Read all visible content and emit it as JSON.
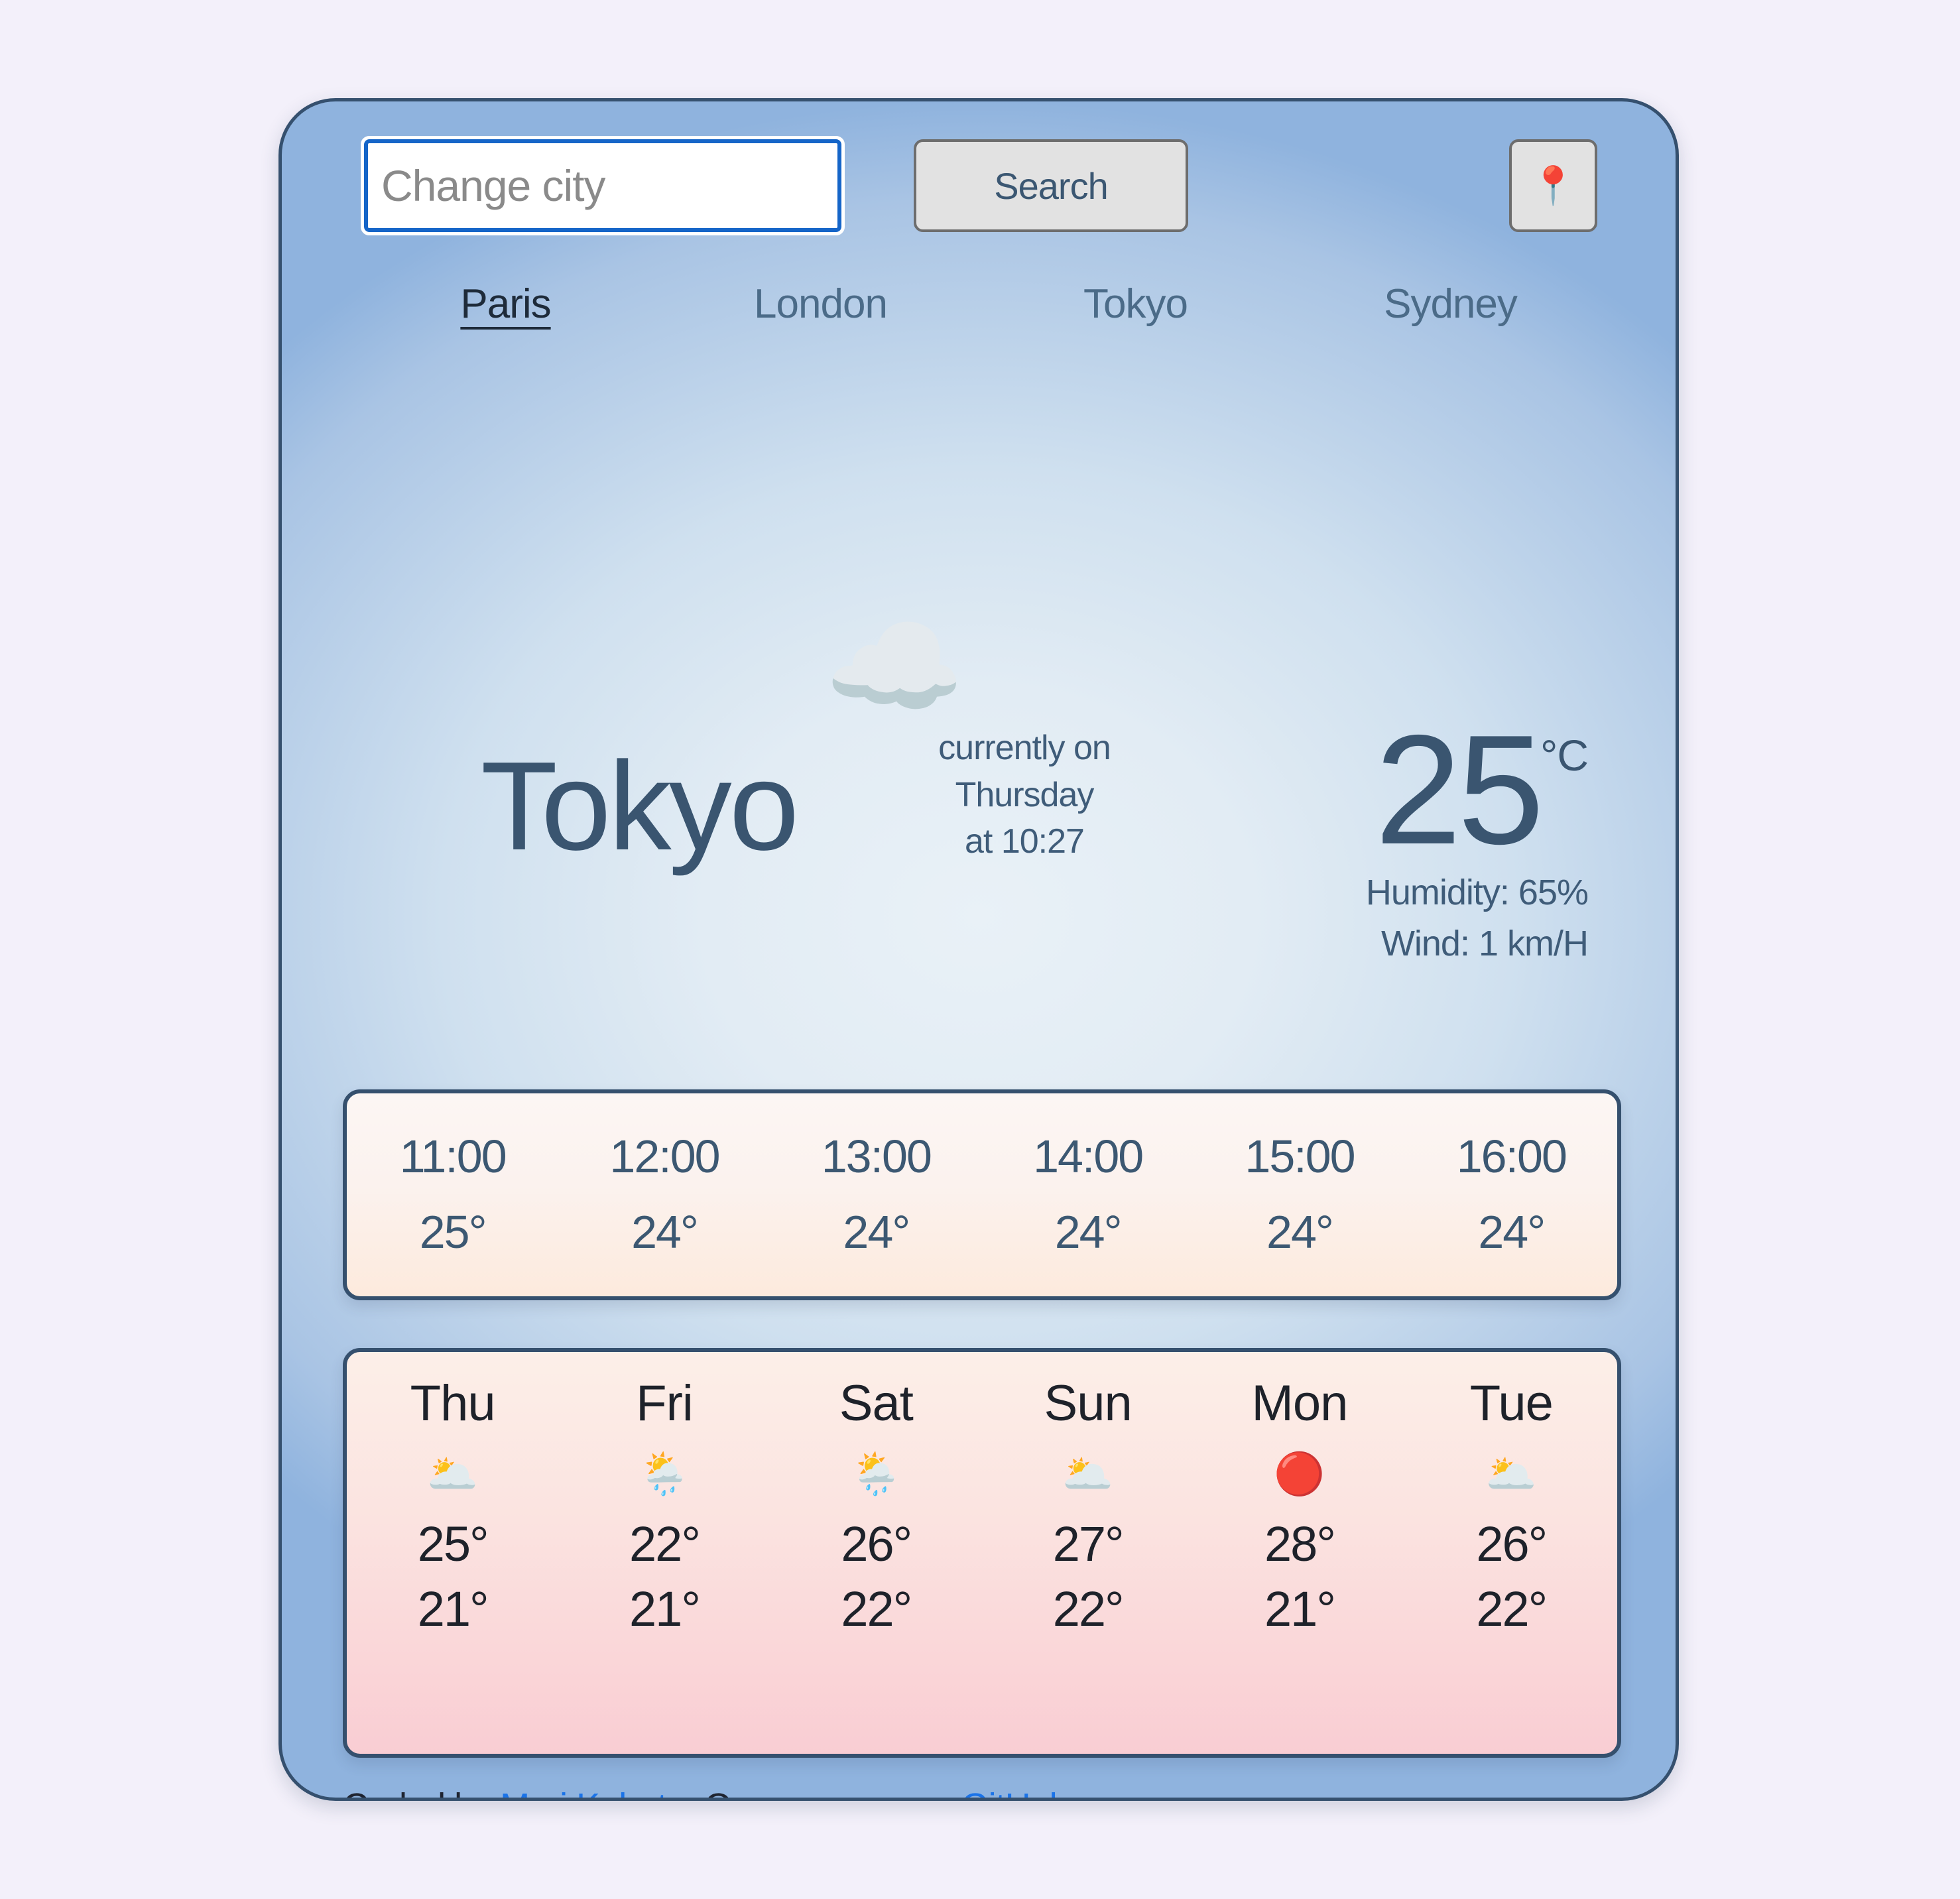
{
  "theme": {
    "page_background": "#f3f0fa",
    "card_border": "#35506e",
    "accent_text": "#3a5570",
    "link_color": "#1a73e8",
    "input_focus_border": "#1565c8"
  },
  "search": {
    "input_value": "",
    "placeholder": "Change city",
    "search_label": "Search",
    "geolocation_icon": "round-pushpin-icon"
  },
  "city_tabs": [
    {
      "label": "Paris",
      "active": true
    },
    {
      "label": "London",
      "active": false
    },
    {
      "label": "Tokyo",
      "active": false
    },
    {
      "label": "Sydney",
      "active": false
    }
  ],
  "current": {
    "icon": "cloud-icon",
    "city": "Tokyo",
    "when_line1": "currently on",
    "when_line2": "Thursday",
    "when_line3": "at 10:27",
    "temperature": "25",
    "unit": "°C",
    "humidity": "Humidity: 65%",
    "wind": "Wind: 1 km/H"
  },
  "hourly": [
    {
      "time": "11:00",
      "temp": "25°"
    },
    {
      "time": "12:00",
      "temp": "24°"
    },
    {
      "time": "13:00",
      "temp": "24°"
    },
    {
      "time": "14:00",
      "temp": "24°"
    },
    {
      "time": "15:00",
      "temp": "24°"
    },
    {
      "time": "16:00",
      "temp": "24°"
    }
  ],
  "daily": [
    {
      "day": "Thu",
      "icon": "broken-clouds-icon",
      "glyph": "🌥️",
      "max": "25°",
      "min": "21°"
    },
    {
      "day": "Fri",
      "icon": "sun-behind-rain-icon",
      "glyph": "🌦️",
      "max": "22°",
      "min": "21°"
    },
    {
      "day": "Sat",
      "icon": "sun-behind-rain-icon",
      "glyph": "🌦️",
      "max": "26°",
      "min": "22°"
    },
    {
      "day": "Sun",
      "icon": "broken-clouds-icon",
      "glyph": "🌥️",
      "max": "27°",
      "min": "22°"
    },
    {
      "day": "Mon",
      "icon": "sun-icon",
      "glyph": "🔴",
      "max": "28°",
      "min": "21°"
    },
    {
      "day": "Tue",
      "icon": "broken-clouds-icon",
      "glyph": "🌥️",
      "max": "26°",
      "min": "22°"
    }
  ],
  "footer": {
    "prefix": "Coded by ",
    "author_link": "Mari Kubota",
    "middle": ", Open-source on ",
    "repo_link": "GitHub",
    "suffix": "."
  }
}
